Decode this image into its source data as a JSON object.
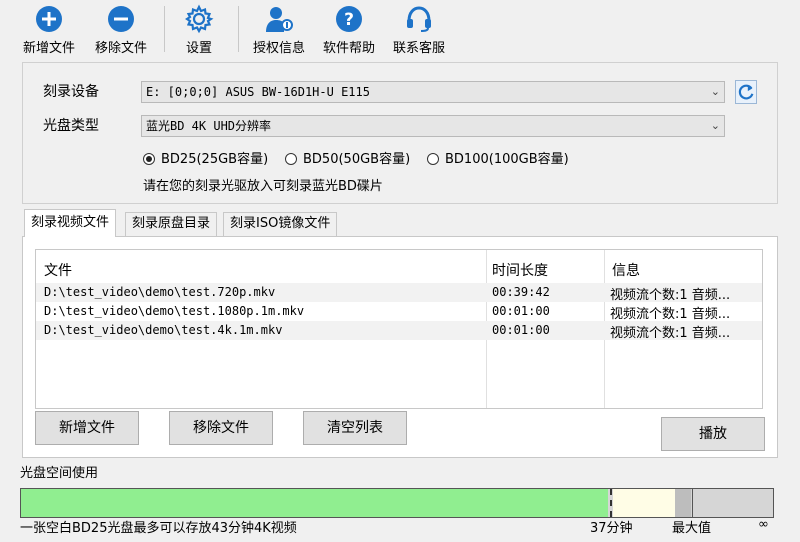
{
  "toolbar": {
    "add_file": "新增文件",
    "remove_file": "移除文件",
    "settings": "设置",
    "license": "授权信息",
    "help": "软件帮助",
    "support": "联系客服"
  },
  "device": {
    "label": "刻录设备",
    "value": "E:  [0;0;0] ASUS BW-16D1H-U E115"
  },
  "disc_type": {
    "label": "光盘类型",
    "value": "蓝光BD 4K UHD分辨率"
  },
  "capacity_options": [
    {
      "label": "BD25(25GB容量)",
      "selected": true
    },
    {
      "label": "BD50(50GB容量)",
      "selected": false
    },
    {
      "label": "BD100(100GB容量)",
      "selected": false
    }
  ],
  "hint": "请在您的刻录光驱放入可刻录蓝光BD碟片",
  "tabs": [
    "刻录视频文件",
    "刻录原盘目录",
    "刻录ISO镜像文件"
  ],
  "file_list": {
    "headers": {
      "file": "文件",
      "duration": "时间长度",
      "info": "信息"
    },
    "rows": [
      {
        "path": "D:\\test_video\\demo\\test.720p.mkv",
        "duration": "00:39:42",
        "info": "视频流个数:1 音频..."
      },
      {
        "path": "D:\\test_video\\demo\\test.1080p.1m.mkv",
        "duration": "00:01:00",
        "info": "视频流个数:1 音频..."
      },
      {
        "path": "D:\\test_video\\demo\\test.4k.1m.mkv",
        "duration": "00:01:00",
        "info": "视频流个数:1 音频..."
      }
    ]
  },
  "buttons": {
    "add": "新增文件",
    "remove": "移除文件",
    "clear": "清空列表",
    "play": "播放"
  },
  "usage": {
    "label": "光盘空间使用",
    "summary": "一张空白BD25光盘最多可以存放43分钟4K视频",
    "marker_label": "37分钟",
    "max_label": "最大值",
    "infinity_label": "∞",
    "used_fraction": 0.78,
    "colors": {
      "used": "#90ee90",
      "remaining": "#fffde6",
      "over": "#d6d6d6"
    }
  },
  "colors": {
    "accent": "#1e73c8"
  }
}
